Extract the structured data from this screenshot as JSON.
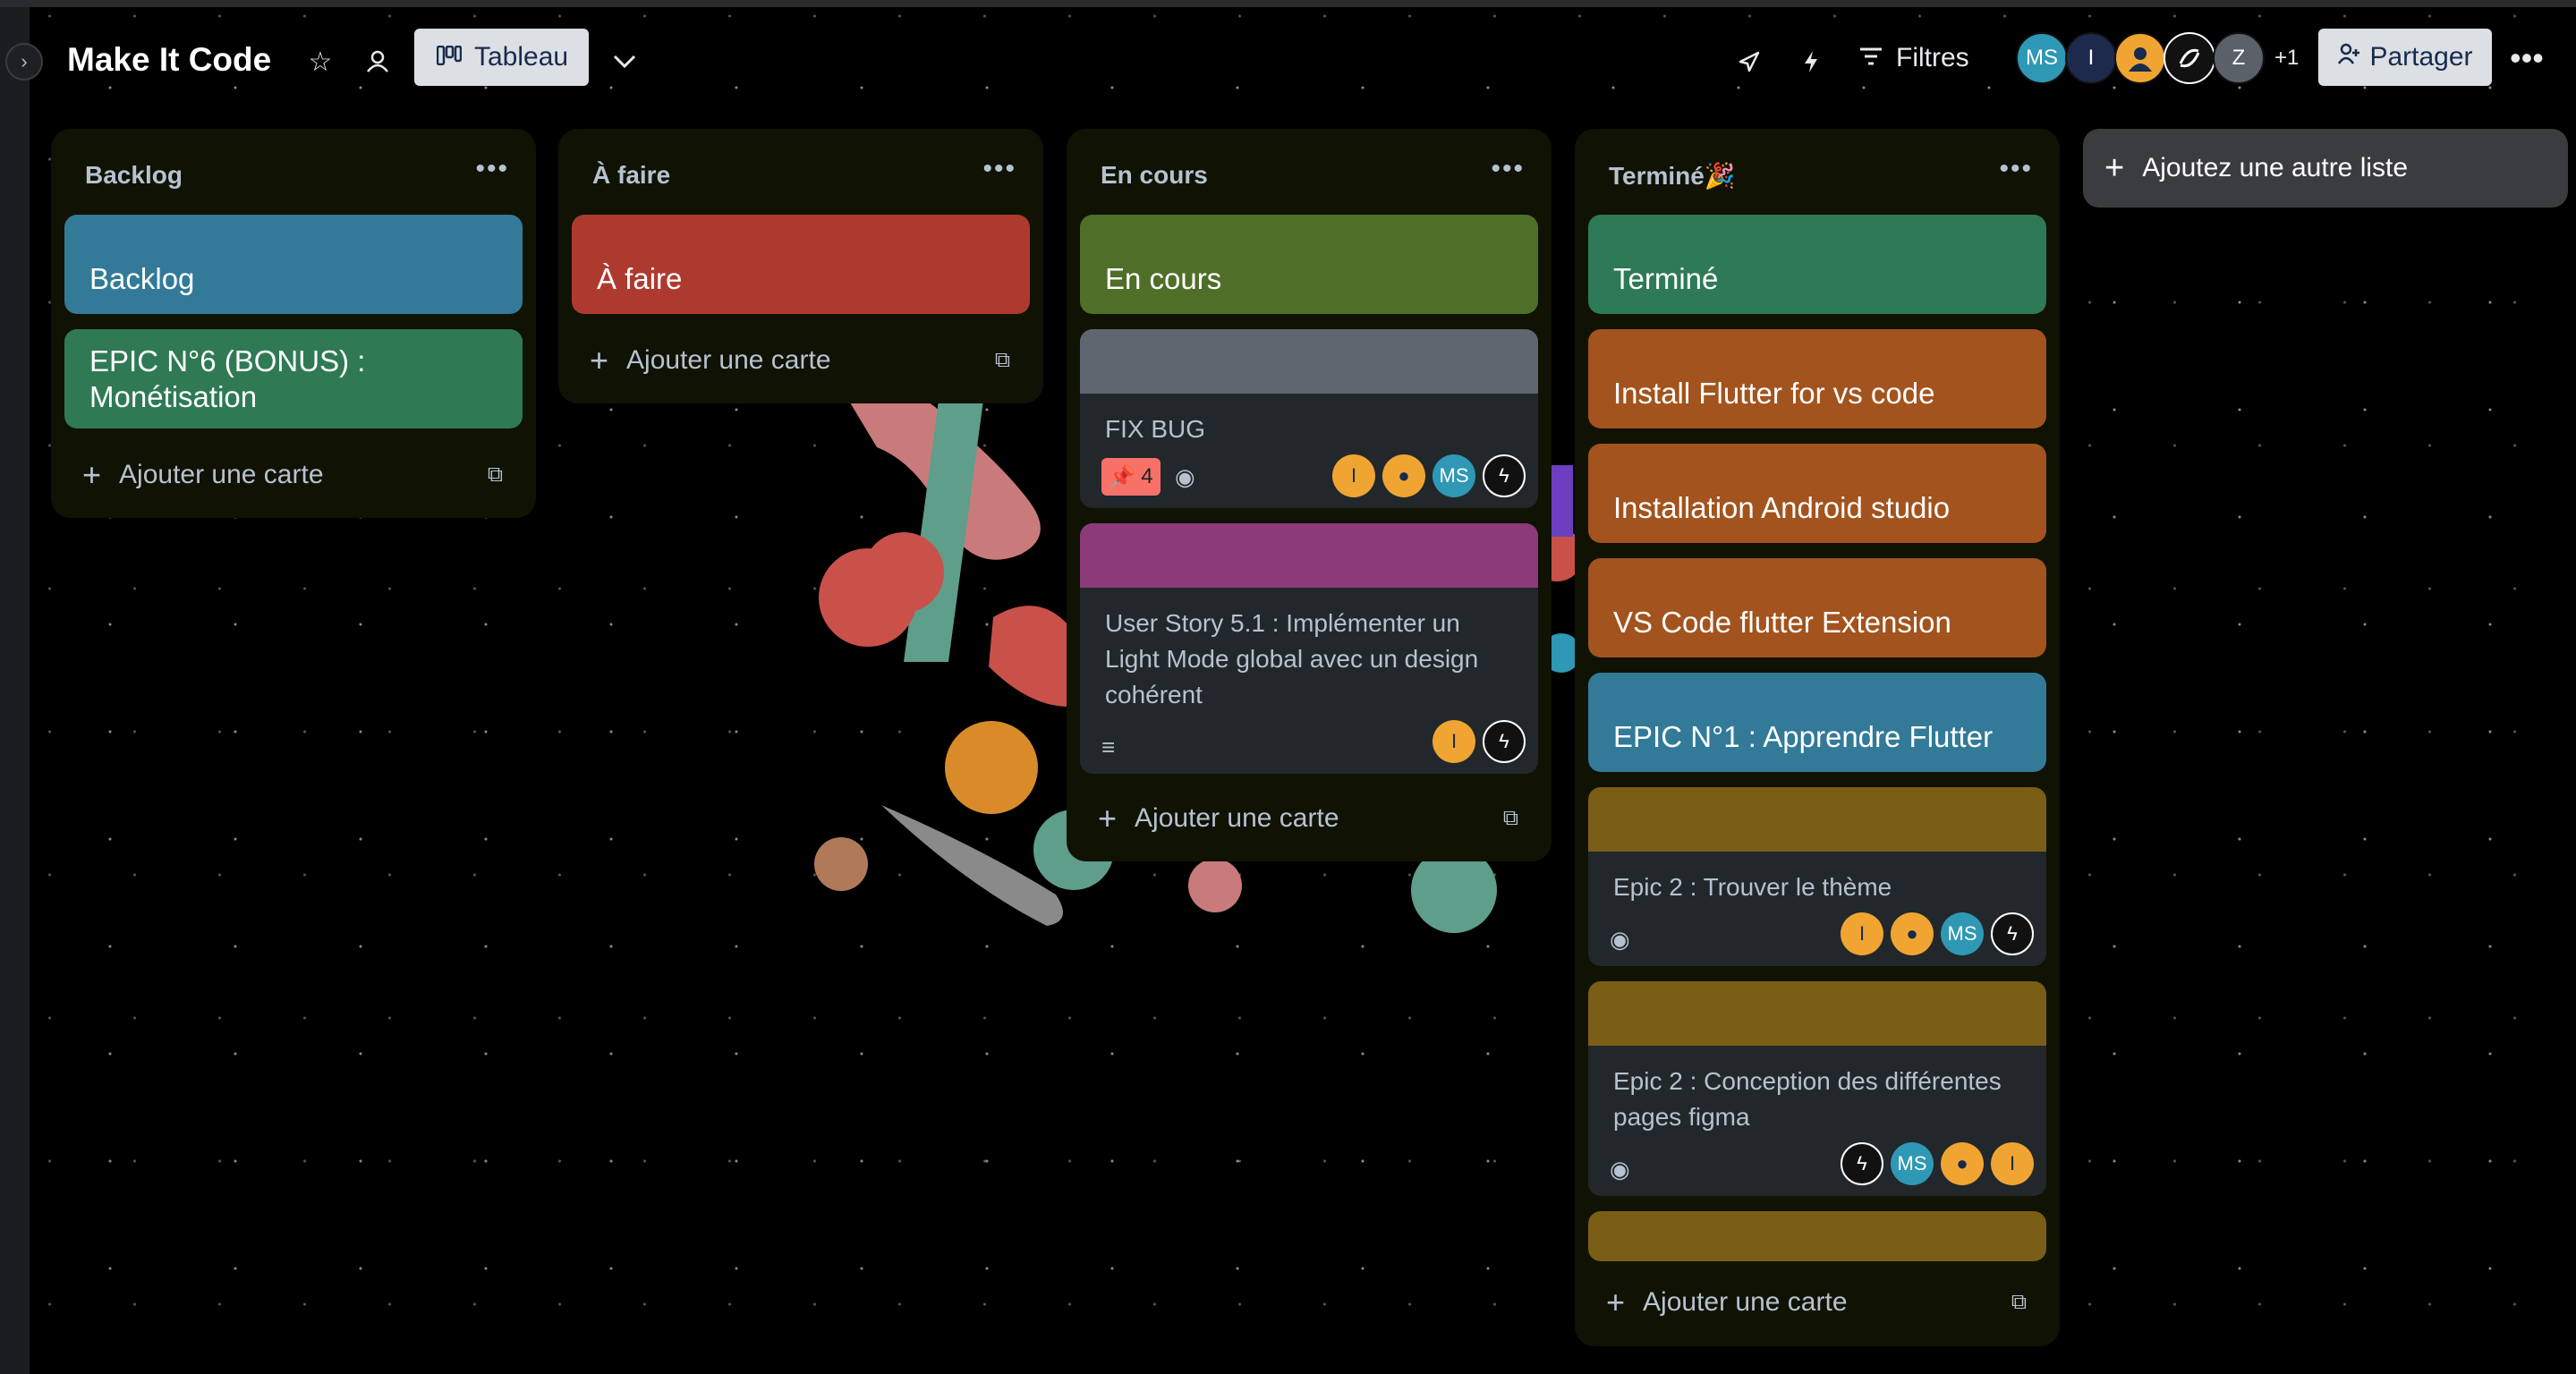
{
  "board": {
    "title": "Make It Code",
    "view_label": "Tableau",
    "filters_label": "Filtres",
    "share_label": "Partager",
    "extra_members": "+1",
    "members": [
      {
        "initials": "MS",
        "color": "#2e98b5"
      },
      {
        "initials": "I",
        "color": "#1d2a4d"
      },
      {
        "initials": "",
        "color": "#f0a533"
      },
      {
        "initials": "",
        "color": "#111111"
      },
      {
        "initials": "Z",
        "color": "#5b6169"
      }
    ]
  },
  "lists": [
    {
      "title": "Backlog",
      "cards": [
        {
          "title": "Backlog",
          "color": "#327a98"
        },
        {
          "title": "EPIC N°6 (BONUS) : Monétisation",
          "color": "#2f7a55"
        }
      ],
      "add_card_label": "Ajouter une carte"
    },
    {
      "title": "À faire",
      "cards": [
        {
          "title": "À faire",
          "color": "#ae3a2f"
        }
      ],
      "add_card_label": "Ajouter une carte"
    },
    {
      "title": "En cours",
      "cards": [
        {
          "title": "En cours",
          "color": "#4f6e27"
        },
        {
          "title": "FIX BUG",
          "cover": "#5f666f",
          "pin_count": "4",
          "members": [
            "I",
            "",
            "MS",
            ""
          ]
        },
        {
          "title": "User Story 5.1 : Implémenter un Light Mode global avec un design cohérent",
          "cover": "#8c3a7a",
          "members": [
            "I",
            ""
          ]
        }
      ],
      "add_card_label": "Ajouter une carte"
    },
    {
      "title": "Terminé🎉",
      "cards": [
        {
          "title": "Terminé",
          "color": "#2e7a56"
        },
        {
          "title": "Install Flutter for vs code",
          "color": "#a3531d"
        },
        {
          "title": "Installation Android studio",
          "color": "#a3531d"
        },
        {
          "title": "VS Code flutter Extension",
          "color": "#a3531d"
        },
        {
          "title": "EPIC N°1 : Apprendre Flutter",
          "color": "#327a98"
        },
        {
          "title": "Epic 2 : Trouver le thème",
          "cover": "#7a5e16",
          "members": [
            "I",
            "",
            "MS",
            ""
          ]
        },
        {
          "title": "Epic 2 : Conception des différentes pages figma",
          "cover": "#7a5e16",
          "members": [
            "",
            "MS",
            "",
            "I"
          ]
        }
      ],
      "add_card_label": "Ajouter une carte"
    }
  ],
  "add_list_label": "Ajoutez une autre liste"
}
